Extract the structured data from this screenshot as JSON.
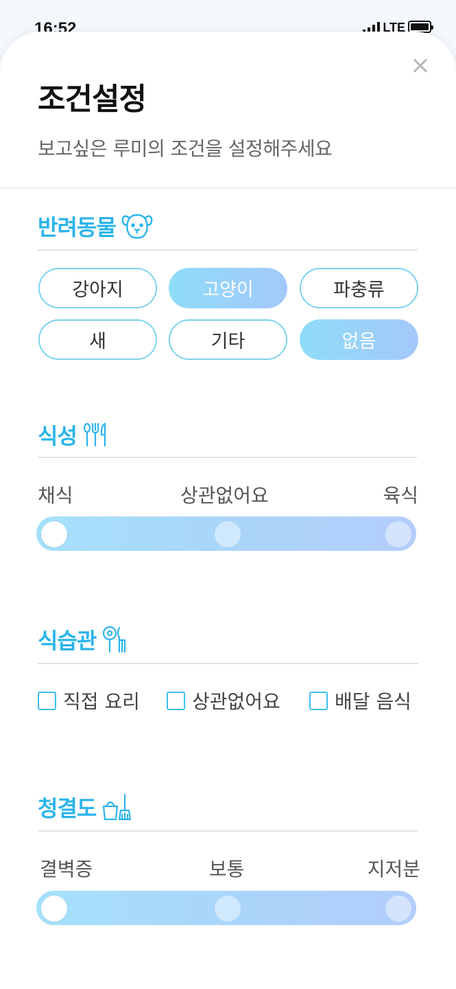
{
  "status_bar": {
    "time": "16:52",
    "network": "LTE"
  },
  "header": {
    "title": "조건설정",
    "subtitle": "보고싶은 루미의 조건을 설정해주세요"
  },
  "colors": {
    "accent": "#2bb4ea",
    "chip_border": "#7dd3ee",
    "slider_start": "#a6e1fb",
    "slider_end": "#b3cdfb"
  },
  "pets": {
    "title": "반려동물",
    "icon": "dog-face-icon",
    "options": [
      {
        "label": "강아지",
        "selected": false
      },
      {
        "label": "고양이",
        "selected": true
      },
      {
        "label": "파충류",
        "selected": false
      },
      {
        "label": "새",
        "selected": false
      },
      {
        "label": "기타",
        "selected": false
      },
      {
        "label": "없음",
        "selected": true
      }
    ]
  },
  "diet": {
    "title": "식성",
    "icon": "utensils-icon",
    "labels": [
      "채식",
      "상관없어요",
      "육식"
    ],
    "selected_index": 0
  },
  "eating": {
    "title": "식습관",
    "icon": "cooking-icon",
    "options": [
      {
        "label": "직접 요리",
        "checked": false
      },
      {
        "label": "상관없어요",
        "checked": false
      },
      {
        "label": "배달 음식",
        "checked": false
      }
    ]
  },
  "cleanliness": {
    "title": "청결도",
    "icon": "cleaning-icon",
    "labels": [
      "결벽증",
      "보통",
      "지저분"
    ],
    "selected_index": 0
  }
}
